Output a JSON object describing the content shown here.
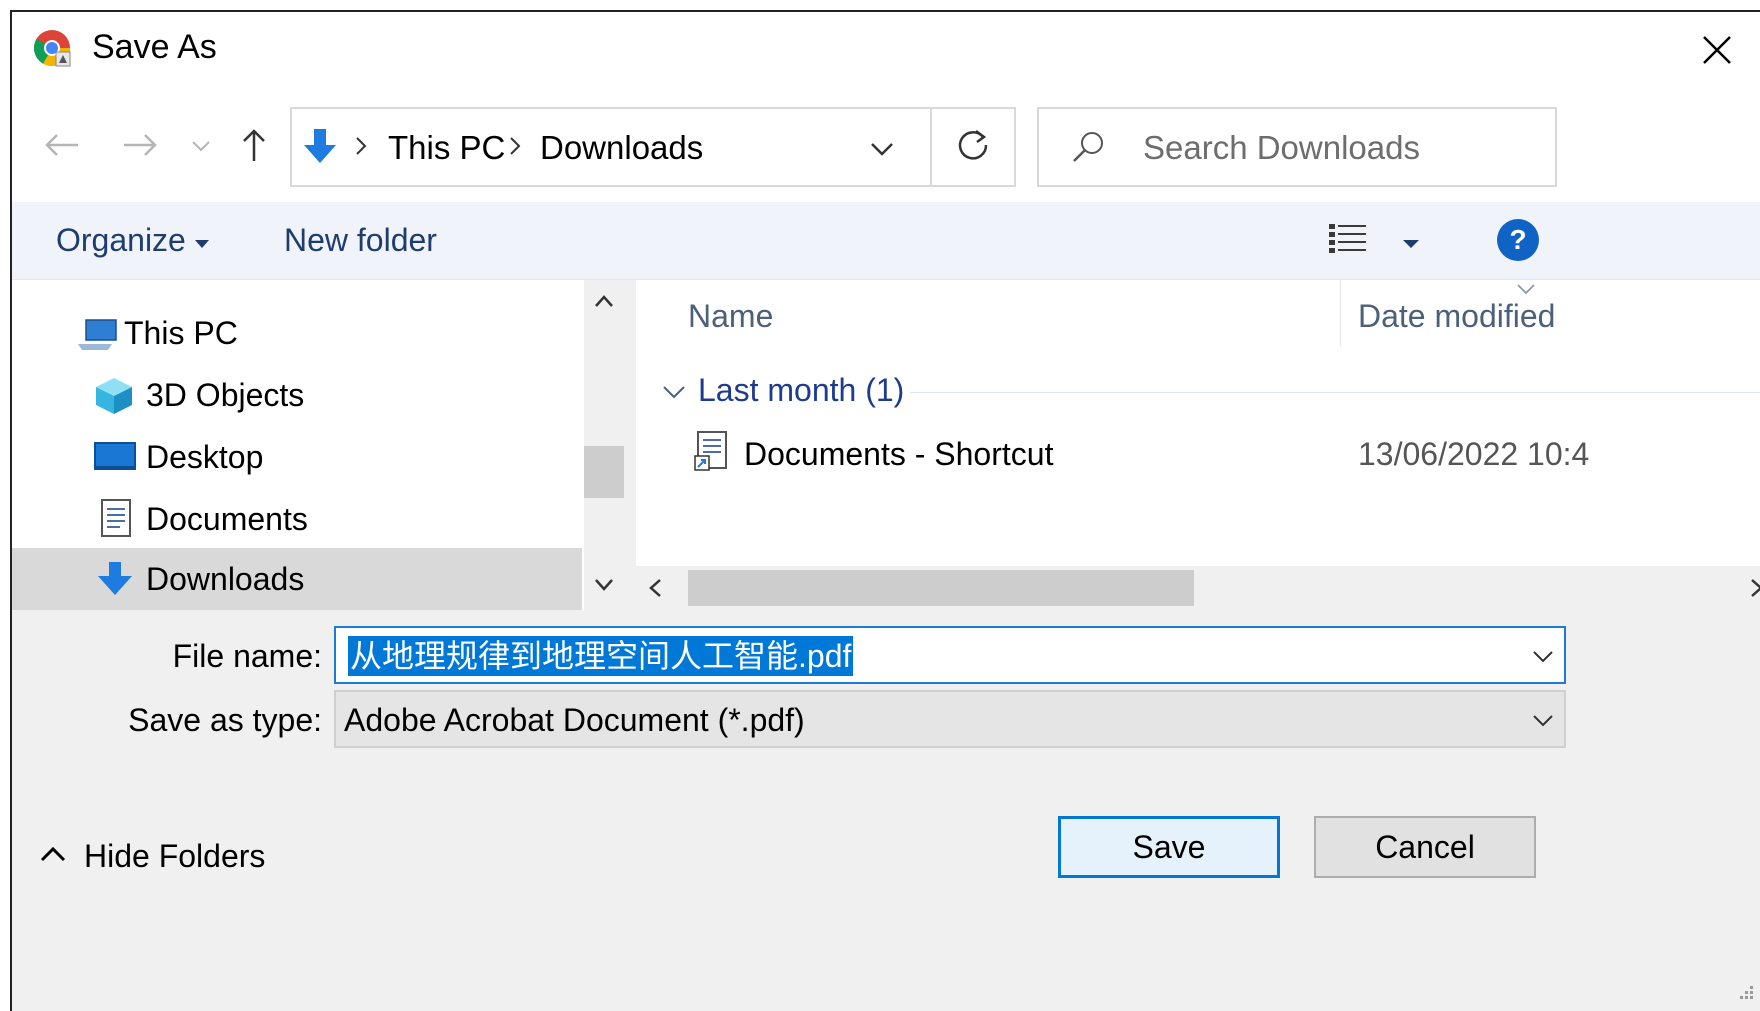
{
  "window": {
    "title": "Save As"
  },
  "address": {
    "crumbs": [
      "This PC",
      "Downloads"
    ]
  },
  "search": {
    "placeholder": "Search Downloads"
  },
  "toolbar": {
    "organize_label": "Organize",
    "new_folder_label": "New folder"
  },
  "tree": {
    "items": [
      {
        "label": "This PC",
        "icon": "computer-icon"
      },
      {
        "label": "3D Objects",
        "icon": "cube-icon"
      },
      {
        "label": "Desktop",
        "icon": "desktop-icon"
      },
      {
        "label": "Documents",
        "icon": "documents-icon"
      },
      {
        "label": "Downloads",
        "icon": "download-arrow-icon",
        "selected": true
      }
    ]
  },
  "files": {
    "columns": [
      "Name",
      "Date modified"
    ],
    "group": {
      "label": "Last month (1)"
    },
    "rows": [
      {
        "name": "Documents - Shortcut",
        "date": "13/06/2022 10:4",
        "icon": "shortcut-icon"
      }
    ]
  },
  "form": {
    "file_name_label": "File name:",
    "file_name_value": "从地理规律到地理空间人工智能.pdf",
    "save_type_label": "Save as type:",
    "save_type_value": "Adobe Acrobat Document (*.pdf)"
  },
  "buttons": {
    "save_label": "Save",
    "cancel_label": "Cancel",
    "hide_folders_label": "Hide Folders"
  },
  "colors": {
    "accent": "#0078d7",
    "link": "#1e3c6e",
    "help": "#0e63c4"
  }
}
